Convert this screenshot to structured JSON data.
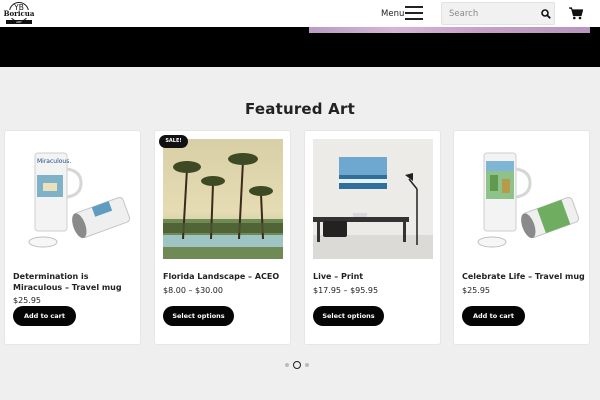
{
  "header": {
    "logo": {
      "line1": "YB",
      "line2": "Boricua",
      "line3": "ART"
    },
    "menu_label": "Menu",
    "search_placeholder": "Search",
    "icons": [
      "hamburger-icon",
      "search-icon",
      "cart-icon"
    ]
  },
  "section": {
    "title": "Featured Art"
  },
  "products": [
    {
      "name": "Determination is Miraculous – Travel mug",
      "price": "$25.95",
      "button": "Add to cart"
    },
    {
      "name": "Florida Landscape – ACEO",
      "price": "$8.00 – $30.00",
      "button": "Select options",
      "badge": "SALE!"
    },
    {
      "name": "Live – Print",
      "price": "$17.95 – $95.95",
      "button": "Select options"
    },
    {
      "name": "Celebrate Life – Travel mug",
      "price": "$25.95",
      "button": "Add to cart"
    }
  ],
  "carousel": {
    "pages": 3,
    "current": 2
  },
  "colors": {
    "background": "#efeff0",
    "hero": "#000000",
    "button": "#050505",
    "card": "#ffffff"
  }
}
